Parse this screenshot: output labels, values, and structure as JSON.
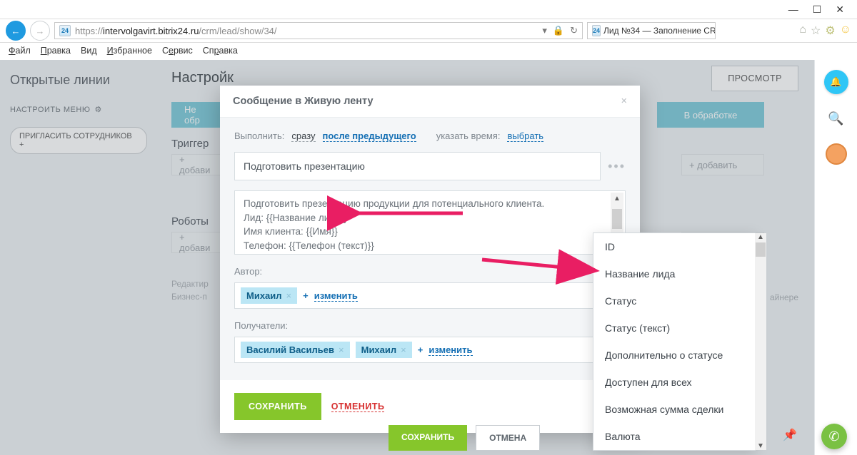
{
  "window": {
    "min": "—",
    "max": "☐",
    "close": "✕"
  },
  "browser": {
    "favicon": "24",
    "url_prefix": "https://",
    "url_host": "intervolgavirt.bitrix24.ru",
    "url_path": "/crm/lead/show/34/",
    "refresh": "↻",
    "lock": "🔒",
    "tab_title": "Лид №34 — Заполнение CR...",
    "tab_close": "×",
    "menu": {
      "file": "Файл",
      "edit": "Правка",
      "view": "Вид",
      "fav": "Избранное",
      "svc": "Сервис",
      "help": "Справка"
    }
  },
  "sidebar": {
    "title": "Открытые линии",
    "configure": "НАСТРОИТЬ МЕНЮ",
    "invite": "ПРИГЛАСИТЬ СОТРУДНИКОВ  +"
  },
  "main": {
    "title": "Настройк",
    "view_btn": "ПРОСМОТР",
    "stage_left": "Не обр",
    "stage_right": "В обработке",
    "triggers_label": "Триггер",
    "add": "+ добави",
    "add_right": "+ добавить",
    "robots_label": "Роботы",
    "hint1": "Редактир",
    "hint2": "Бизнес-п",
    "hint_right": "айнере"
  },
  "modal": {
    "title": "Сообщение в Живую ленту",
    "close": "×",
    "exec_label": "Выполнить:",
    "opt_now": "сразу",
    "opt_after": "после предыдущего",
    "time_label": "указать время:",
    "opt_time": "выбрать",
    "subject": "Подготовить презентацию",
    "body_l1": "Подготовить презентацию продукции для потенциального клиента.",
    "body_l2": "Лид: {{Название лида}}",
    "body_l3": "Имя клиента: {{Имя}}",
    "body_l4": "Телефон: {{Телефон (текст)}}",
    "author_label": "Автор:",
    "author_chip": "Михаил",
    "change": "изменить",
    "recipients_label": "Получатели:",
    "recipient1": "Василий Васильев",
    "recipient2": "Михаил",
    "save": "СОХРАНИТЬ",
    "cancel": "ОТМЕНИТЬ"
  },
  "dropdown": {
    "items": [
      "ID",
      "Название лида",
      "Статус",
      "Статус (текст)",
      "Дополнительно о статусе",
      "Доступен для всех",
      "Возможная сумма сделки",
      "Валюта"
    ]
  },
  "bottom": {
    "save": "СОХРАНИТЬ",
    "cancel": "ОТМЕНА"
  }
}
